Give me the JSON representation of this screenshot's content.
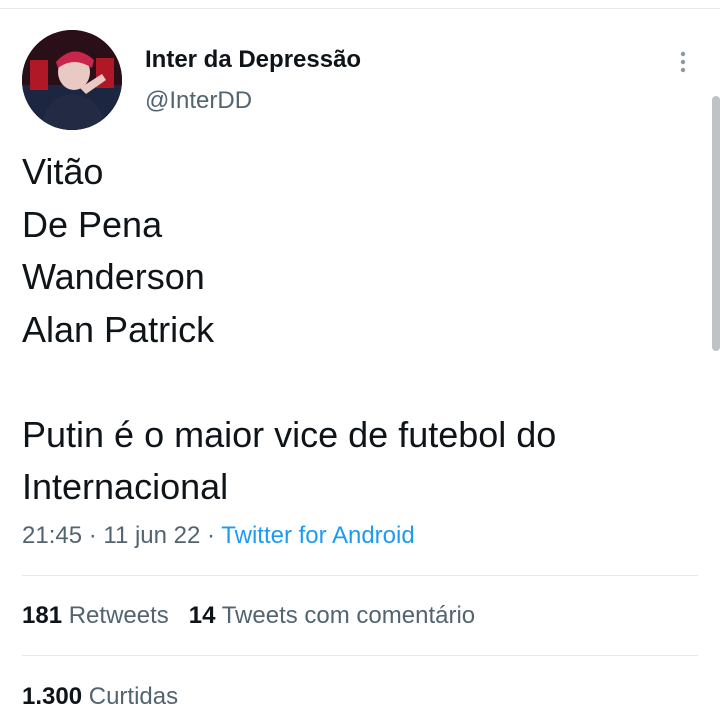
{
  "author": {
    "display_name": "Inter da Depressão",
    "handle": "@InterDD"
  },
  "tweet": {
    "lines": [
      "Vitão",
      "De Pena",
      "Wanderson",
      "Alan Patrick",
      "",
      "Putin é o maior vice de futebol do",
      "Internacional"
    ]
  },
  "meta": {
    "time": "21:45",
    "separator1": " · ",
    "date": "11 jun 22",
    "separator2": " · ",
    "source": "Twitter for Android"
  },
  "stats": {
    "retweets_count": "181",
    "retweets_label": "Retweets",
    "quotes_count": "14",
    "quotes_label": "Tweets com comentário",
    "likes_count": "1.300",
    "likes_label": "Curtidas"
  },
  "icons": {
    "more": "more-vertical-icon"
  },
  "colors": {
    "text_primary": "#0f1419",
    "text_secondary": "#536471",
    "link": "#1d9bf0",
    "divider": "#e7e9ea"
  }
}
